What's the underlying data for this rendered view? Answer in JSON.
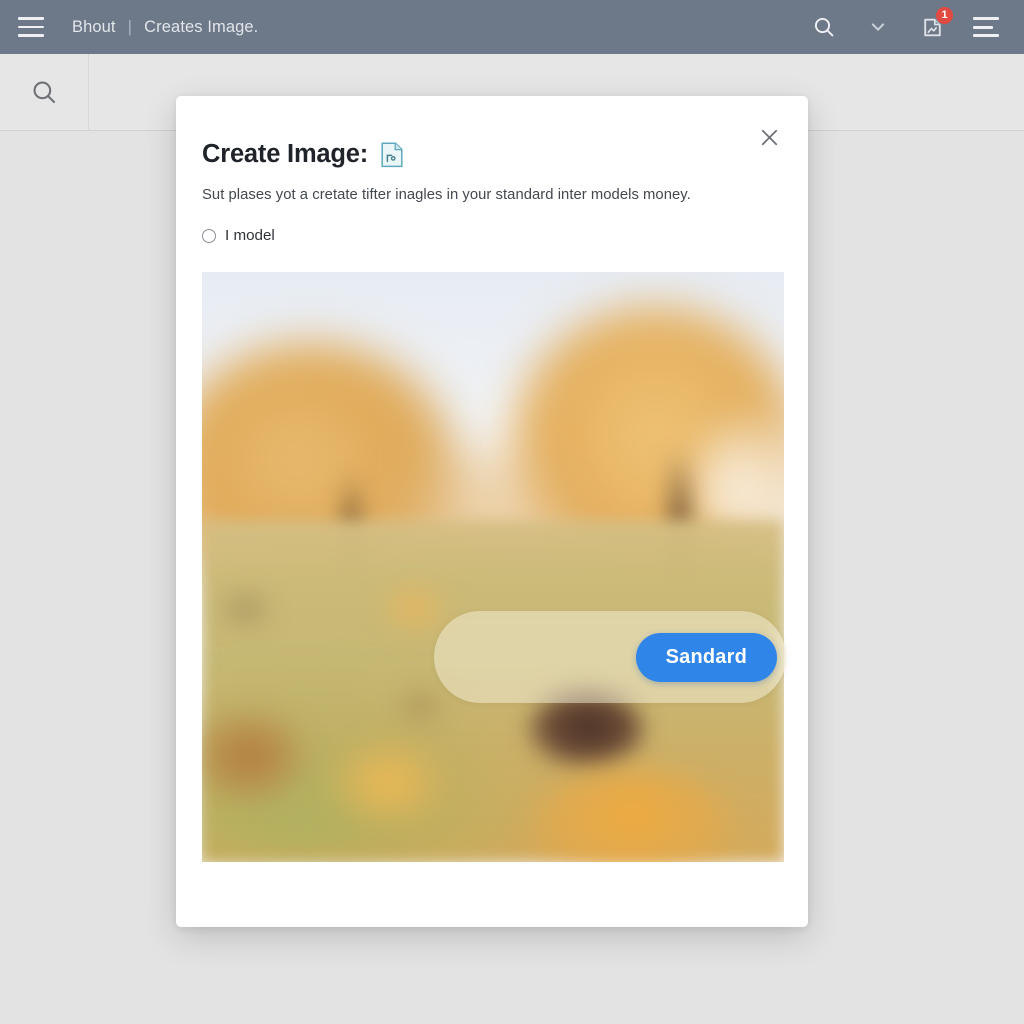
{
  "header": {
    "menu_icon": "hamburger-icon",
    "breadcrumb": {
      "root": "Bhout",
      "separator": "|",
      "current": "Creates Image."
    },
    "actions": {
      "search_icon": "search-icon",
      "chevron_icon": "chevron-down-icon",
      "notifications_icon": "document-notification-icon",
      "notifications_count": "1",
      "list_icon": "list-menu-icon"
    },
    "bg_color": "#6d7889",
    "badge_color": "#e04a41"
  },
  "subbar": {
    "search_icon": "search-icon",
    "bg_color": "#e6e6e6"
  },
  "modal": {
    "title": "Create Image:",
    "title_icon": "document-image-icon",
    "close_icon": "close-icon",
    "description": "Sut plases yot a cretate tifter inagles in your standard inter models money.",
    "option": {
      "label": "I model",
      "selected": false
    },
    "preview": {
      "alt": "blurred autumn meadow with golden trees",
      "overlay_button_label": "Sandard",
      "overlay_button_color": "#2f85e8"
    }
  },
  "page": {
    "bg_color": "#e3e3e3"
  }
}
